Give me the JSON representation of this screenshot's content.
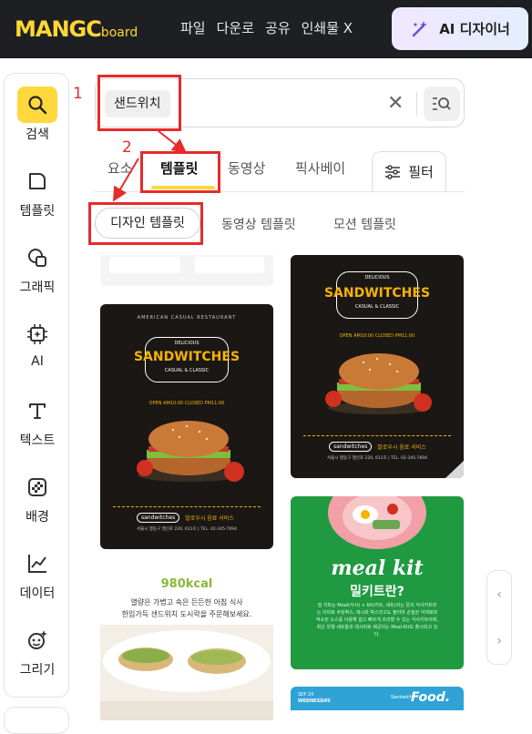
{
  "header": {
    "logo_main": "MANGC",
    "logo_sub": "board",
    "nav": [
      "파일",
      "다운로",
      "공유",
      "인쇄물 X"
    ],
    "ai_button": "AI 디자이너"
  },
  "sidebar": {
    "items": [
      {
        "label": "검색",
        "icon": "search-icon",
        "active": true
      },
      {
        "label": "템플릿",
        "icon": "template-icon"
      },
      {
        "label": "그래픽",
        "icon": "graphic-icon"
      },
      {
        "label": "AI",
        "icon": "ai-chip-icon"
      },
      {
        "label": "텍스트",
        "icon": "text-icon"
      },
      {
        "label": "배경",
        "icon": "background-icon"
      },
      {
        "label": "데이터",
        "icon": "chart-icon"
      },
      {
        "label": "그리기",
        "icon": "draw-icon"
      }
    ]
  },
  "search": {
    "chip": "샌드위치"
  },
  "tabs": {
    "items": [
      "요소",
      "템플릿",
      "동영상",
      "픽사베이"
    ],
    "filter_label": "필터"
  },
  "subtabs": {
    "items": [
      "디자인 템플릿",
      "동영상 템플릿",
      "모션 템플릿"
    ]
  },
  "annotations": {
    "num1": "1",
    "num2": "2"
  },
  "cards": {
    "poster1": {
      "top": "AMERICAN CASUAL RESTAURANT",
      "delicious": "DELICIOUS",
      "title": "SANDWITCHES",
      "subtitle": "CASUAL & CLASSIC",
      "hours": "OPEN AM10:00   CLOSED PM11:00",
      "sns": "sandwitches",
      "delivery": "발로우시 음료 서비스",
      "address": "서울시 행동구 행신로 220, 611호  |  TEL. 02-345-7694"
    },
    "poster2": {
      "delicious": "DELICIOUS",
      "title": "SANDWITCHES",
      "subtitle": "CASUAL & CLASSIC",
      "hours": "OPEN AM10:00   CLOSED PM11:00",
      "sns": "sandwitches",
      "delivery": "발로우시 음료 서비스",
      "address": "서울시 행동구 행신로 220, 611호  |  TEL. 02-345-7694"
    },
    "kcal": {
      "amount": "980kcal",
      "line1": "열량은 가볍고 속은 든든한 아침 식사",
      "line2": "한입가득 샌드위치 도시락을 주문해보세요."
    },
    "mealkit": {
      "title": "meal kit",
      "subtitle": "밀키트란?",
      "body": "밀 키트는 Meal(식사) + Kit(키트, 세트)라는 뜻의 식사키트라는 의미로 쿠킹박스, 레시피 박스라고도 불리며 손질된 식재료와 적소된 소스를 이용해 쉽고 빠르게 조리할 수 있는 식사키트이며, 최근 유행 세트들과 레시피로 제공되는 Meal-Kit도 출시되고 있다."
    },
    "blue": {
      "date1": "SEP 24",
      "date2": "WEDNESDAY.",
      "small": "Sandwich",
      "title": "Food."
    }
  },
  "colors": {
    "brand": "#fdd835",
    "accent": "#ffd83d",
    "annotation": "#e52b2b",
    "green": "#1f9a41"
  }
}
